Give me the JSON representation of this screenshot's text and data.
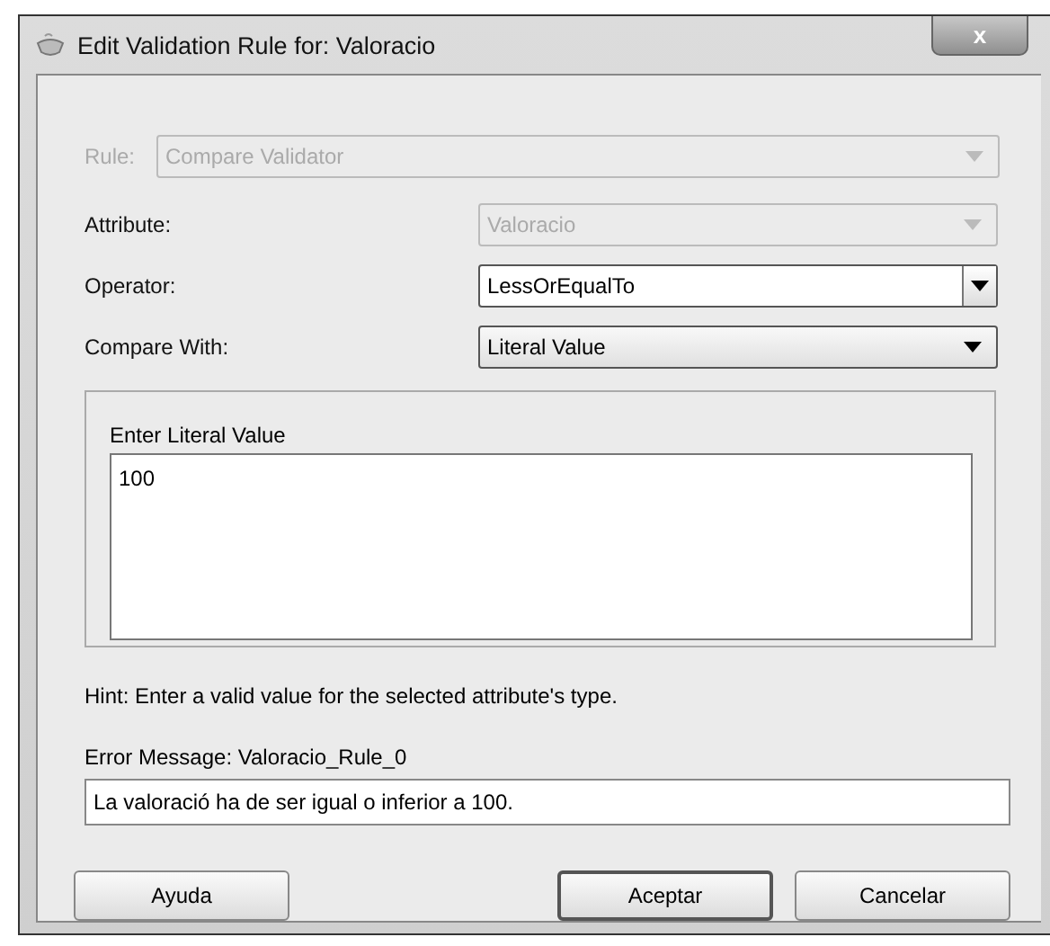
{
  "window": {
    "title": "Edit Validation Rule for: Valoracio",
    "close": "x"
  },
  "rule": {
    "label": "Rule:",
    "value": "Compare Validator",
    "disabled": true
  },
  "fields": [
    {
      "label": "Attribute:",
      "value": "Valoracio",
      "disabled": true,
      "kind": "flat"
    },
    {
      "label": "Operator:",
      "value": "LessOrEqualTo",
      "disabled": false,
      "kind": "editable"
    },
    {
      "label": "Compare With:",
      "value": "Literal Value",
      "disabled": false,
      "kind": "button"
    }
  ],
  "literal": {
    "label": "Enter Literal Value",
    "value": "100"
  },
  "hint": "Hint: Enter a valid value for the selected attribute's type.",
  "error": {
    "label": "Error Message: Valoracio_Rule_0",
    "value": "La valoració ha de ser igual o inferior a 100."
  },
  "buttons": [
    {
      "label": "Ayuda",
      "default": false
    },
    {
      "label": "Aceptar",
      "default": true
    },
    {
      "label": "Cancelar",
      "default": false
    }
  ]
}
